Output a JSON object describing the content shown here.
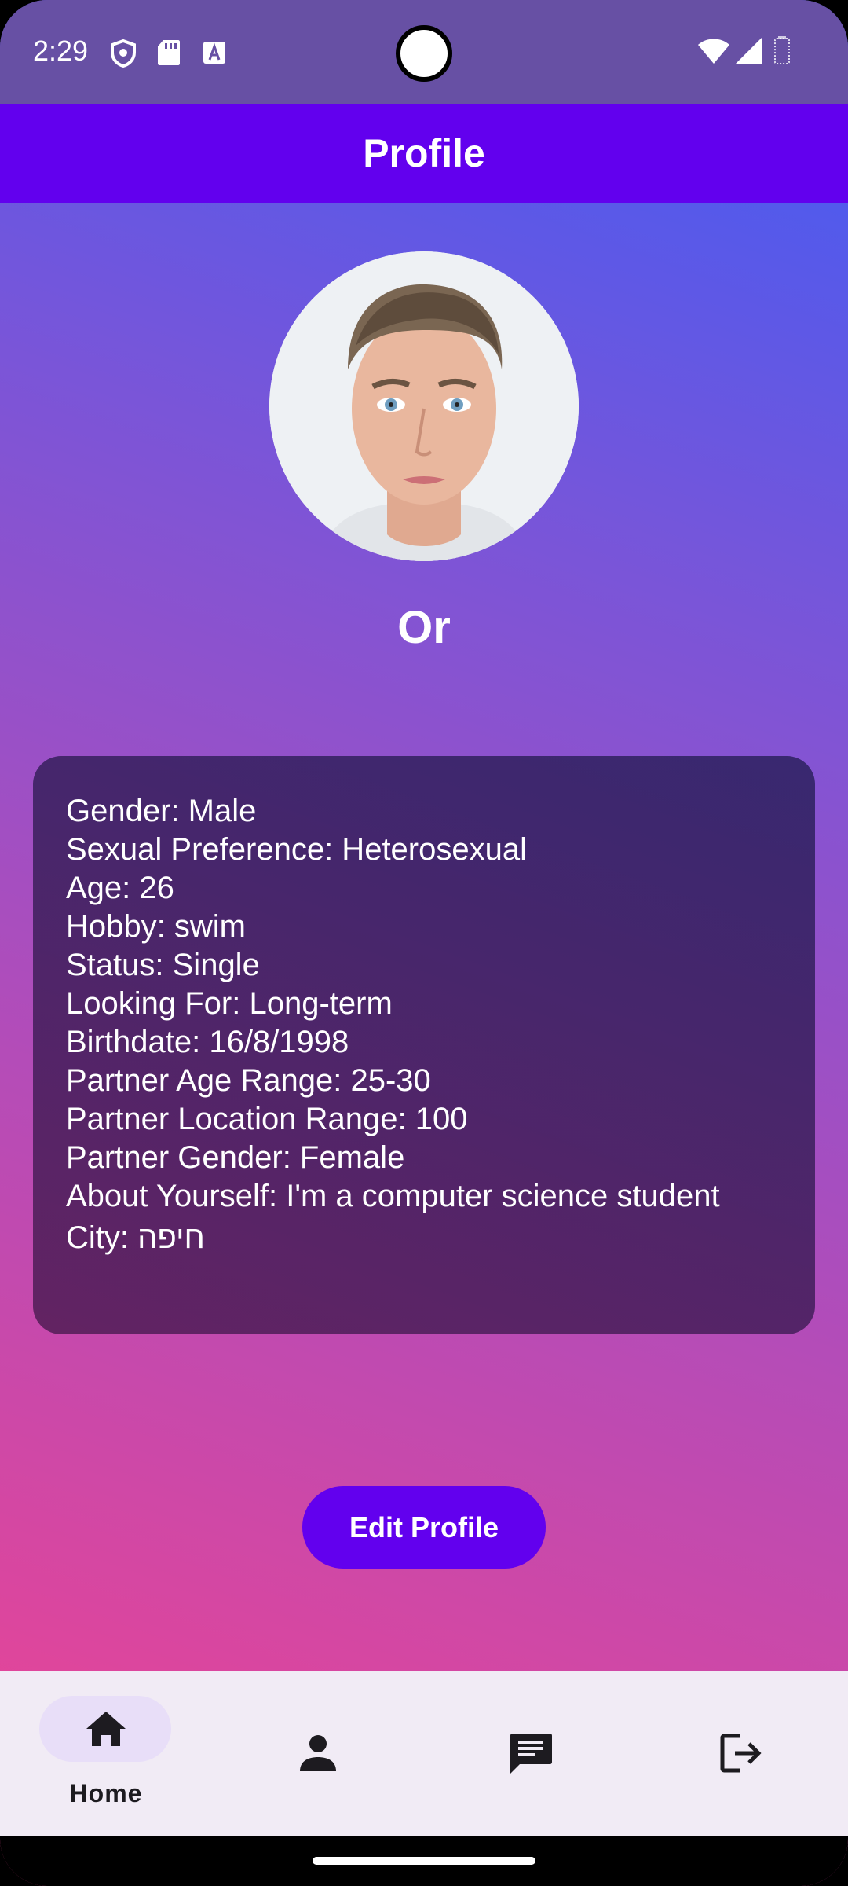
{
  "status_bar": {
    "time": "2:29",
    "icons": [
      "shield-icon",
      "sd-card-icon",
      "a-box-icon",
      "wifi-icon",
      "cell-signal-icon",
      "battery-icon"
    ]
  },
  "app_bar": {
    "title": "Profile"
  },
  "profile": {
    "name": "Or",
    "info": [
      "Gender: Male",
      "Sexual Preference: Heterosexual",
      "Age: 26",
      "Hobby: swim",
      "Status: Single",
      "Looking For: Long-term",
      "Birthdate: 16/8/1998",
      "Partner Age Range: 25-30",
      "Partner Location Range: 100",
      "Partner Gender: Female",
      "About Yourself: I'm a computer science student",
      "City: חיפה"
    ]
  },
  "actions": {
    "edit_label": "Edit Profile"
  },
  "bottom_nav": {
    "items": [
      {
        "icon": "home-icon",
        "label": "Home",
        "selected": true
      },
      {
        "icon": "person-icon",
        "label": "",
        "selected": false
      },
      {
        "icon": "chat-icon",
        "label": "",
        "selected": false
      },
      {
        "icon": "logout-icon",
        "label": "",
        "selected": false
      }
    ]
  },
  "colors": {
    "status_bar": "#6750a4",
    "app_bar": "#6200ee",
    "button": "#6200ee",
    "gradient_top": "#3f5cf5",
    "gradient_bottom": "#ef4391",
    "nav_bg": "#f1ebf5",
    "nav_pill": "#e8def8"
  }
}
